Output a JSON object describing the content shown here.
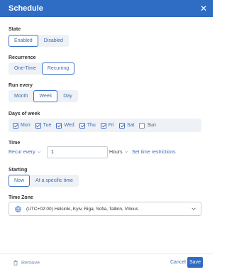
{
  "dialog": {
    "title": "Schedule",
    "close_icon": "close-icon"
  },
  "state": {
    "label": "State",
    "options": [
      "Enabled",
      "Disabled"
    ],
    "selected": "Enabled"
  },
  "recurrence": {
    "label": "Recurrence",
    "options": [
      "One-Time",
      "Recurring"
    ],
    "selected": "Recurring"
  },
  "run_every": {
    "label": "Run every",
    "options": [
      "Month",
      "Week",
      "Day"
    ],
    "selected": "Week"
  },
  "days_of_week": {
    "label": "Days of week",
    "days": [
      {
        "label": "Mon",
        "checked": true
      },
      {
        "label": "Tue",
        "checked": true
      },
      {
        "label": "Wed",
        "checked": true
      },
      {
        "label": "Thu",
        "checked": true
      },
      {
        "label": "Fri",
        "checked": true
      },
      {
        "label": "Sat",
        "checked": true
      },
      {
        "label": "Sun",
        "checked": false
      }
    ]
  },
  "time": {
    "label": "Time",
    "recur_label": "Recur every",
    "value": "1",
    "unit": "Hours",
    "restrictions_link": "Set time restrictions"
  },
  "starting": {
    "label": "Starting",
    "options": [
      "Now",
      "At a specific time"
    ],
    "selected": "Now"
  },
  "time_zone": {
    "label": "Time Zone",
    "value": "(UTC+02:00) Helsinki, Kyiv, Riga, Sofia, Tallinn, Vilnius"
  },
  "footer": {
    "remove_label": "Remove",
    "cancel_label": "Cancel",
    "save_label": "Save"
  },
  "colors": {
    "accent": "#2f6cc4",
    "link": "#3d6db5",
    "segment_bg": "#eef1f5"
  }
}
